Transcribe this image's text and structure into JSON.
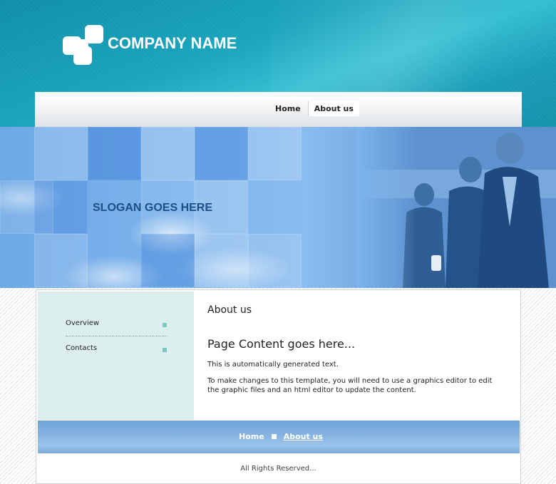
{
  "header": {
    "company_name": "COMPANY NAME",
    "logo_icon": "company-logo-icon"
  },
  "nav": {
    "items": [
      {
        "label": "Home",
        "active": false
      },
      {
        "label": "About us",
        "active": true
      }
    ]
  },
  "banner": {
    "slogan": "SLOGAN GOES HERE"
  },
  "sidebar": {
    "items": [
      {
        "label": "Overview"
      },
      {
        "label": "Contacts"
      }
    ],
    "bullet_icon": "square-bullet-icon"
  },
  "main": {
    "section_title": "About us",
    "heading": "Page Content goes here...",
    "paragraph1": "This is automatically generated text.",
    "paragraph2": "To make changes to this template, you will need to use a graphics editor to edit the graphic files and an html editor to update the content."
  },
  "footer": {
    "links": [
      {
        "label": "Home",
        "active": false
      },
      {
        "label": "About us",
        "active": true
      }
    ],
    "copyright": "All Rights Reserved..."
  },
  "colors": {
    "header_teal": "#1aa4bd",
    "banner_blue": "#7db4ec",
    "sidebar_bg": "#dcefee",
    "footer_blue": "#86b4e1",
    "bullet": "#7dc5c0"
  }
}
